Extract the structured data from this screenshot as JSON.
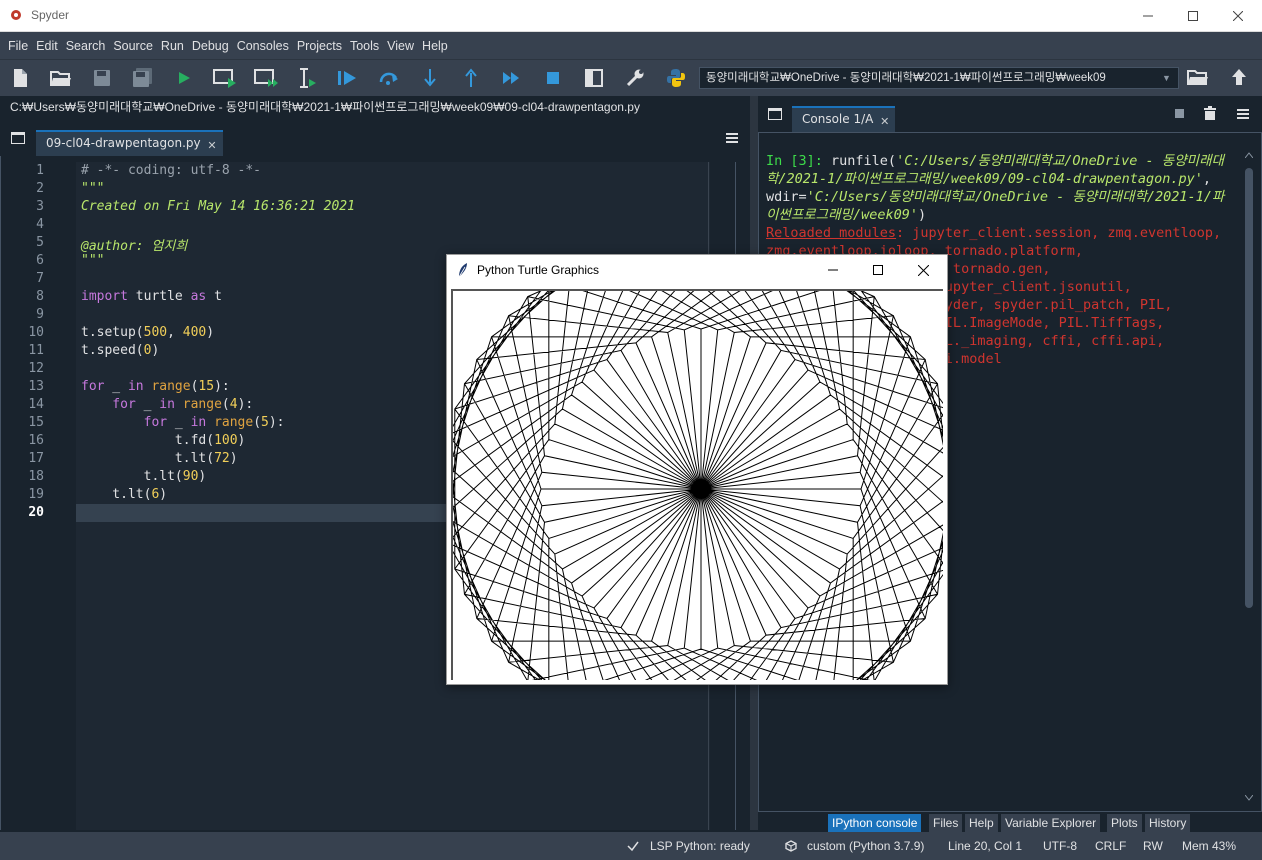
{
  "window": {
    "title": "Spyder"
  },
  "menu": [
    "File",
    "Edit",
    "Search",
    "Source",
    "Run",
    "Debug",
    "Consoles",
    "Projects",
    "Tools",
    "View",
    "Help"
  ],
  "toolbar": {
    "working_dir": "동양미래대학교₩OneDrive - 동양미래대학₩2021-1₩파이썬프로그래밍₩week09"
  },
  "editor": {
    "path": "C:₩Users₩동양미래대학교₩OneDrive - 동양미래대학₩2021-1₩파이썬프로그래밍₩week09₩09-cl04-drawpentagon.py",
    "tab_label": "09-cl04-drawpentagon.py",
    "line_numbers": [
      "1",
      "2",
      "3",
      "4",
      "5",
      "6",
      "7",
      "8",
      "9",
      "10",
      "11",
      "12",
      "13",
      "14",
      "15",
      "16",
      "17",
      "18",
      "19",
      "20"
    ],
    "code": {
      "l1": "# -*- coding: utf-8 -*-",
      "l2": "\"\"\"",
      "l3": "Created on Fri May 14 16:36:21 2021",
      "l5": "@author: 엄지희",
      "l6": "\"\"\"",
      "l8_a": "import",
      "l8_b": " turtle ",
      "l8_c": "as",
      "l8_d": " t",
      "l10_a": "t.setup(",
      "l10_b": "500",
      "l10_c": ", ",
      "l10_d": "400",
      "l10_e": ")",
      "l11_a": "t.speed(",
      "l11_b": "0",
      "l11_c": ")",
      "l13_a": "for",
      "l13_b": " _ ",
      "l13_c": "in",
      "l13_d": " ",
      "l13_e": "range",
      "l13_f": "(",
      "l13_g": "15",
      "l13_h": "):",
      "l14_a": "    for",
      "l14_b": " _ ",
      "l14_c": "in",
      "l14_d": " ",
      "l14_e": "range",
      "l14_f": "(",
      "l14_g": "4",
      "l14_h": "):",
      "l15_a": "        for",
      "l15_b": " _ ",
      "l15_c": "in",
      "l15_d": " ",
      "l15_e": "range",
      "l15_f": "(",
      "l15_g": "5",
      "l15_h": "):",
      "l16_a": "            t.fd(",
      "l16_b": "100",
      "l16_c": ")",
      "l17_a": "            t.lt(",
      "l17_b": "72",
      "l17_c": ")",
      "l18_a": "        t.lt(",
      "l18_b": "90",
      "l18_c": ")",
      "l19_a": "    t.lt(",
      "l19_b": "6",
      "l19_c": ")"
    }
  },
  "console": {
    "tab_label": "Console 1/A",
    "prompt": "In [3]:",
    "call": " runfile(",
    "file_arg": "'C:/Users/동양미래대학교/OneDrive - 동양미래대학/2021-1/파이썬프로그래밍/week09/09-cl04-drawpentagon.py'",
    "wdir_label": ", wdir=",
    "wdir_arg": "'C:/Users/동양미래대학교/OneDrive - 동양미래대학/2021-1/파이썬프로그래밍/week09'",
    "close_paren": ")",
    "reloaded_label": "Reloaded modules",
    "reloaded_lines": [
      ": jupyter_client.session, zmq.eventloop,",
      "zmq.eventloop.ioloop, tornado.platform,",
      "                    o, tornado.gen,",
      "                   , jupyter_client.jsonutil,",
      "                    spyder, spyder.pil_patch, PIL,",
      "                   , PIL.ImageMode, PIL.TiffTags,",
      "                    PIL._imaging, cffi, cffi.api,",
      "                   cffi.model"
    ]
  },
  "bottom_tabs": [
    "IPython console",
    "Files",
    "Help",
    "Variable Explorer",
    "Plots",
    "History"
  ],
  "status": {
    "lsp": "LSP Python: ready",
    "env": "custom (Python 3.7.9)",
    "position": "Line 20, Col 1",
    "encoding": "UTF-8",
    "eol": "CRLF",
    "perm": "RW",
    "mem": "Mem 43%"
  },
  "turtle_window": {
    "title": "Python Turtle Graphics",
    "program": {
      "outer_loops": 15,
      "squares": 4,
      "pentagon_sides": 5,
      "side_length": 100,
      "pentagon_turn_deg": 72,
      "square_turn_deg": 90,
      "outer_turn_deg": 6
    }
  },
  "colors": {
    "accent": "#1a72bb",
    "background": "#19232d",
    "panel": "#37414f"
  }
}
